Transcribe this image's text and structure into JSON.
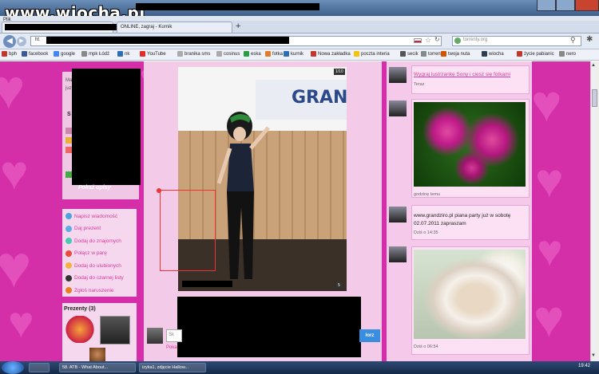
{
  "window": {
    "site_logo": "www.wiocha.pl"
  },
  "menu": {
    "first": "Plik"
  },
  "tabs": [
    {
      "label": ""
    },
    {
      "label": "ONLINE, zagraj - Kurnik"
    }
  ],
  "urlbar": {
    "url": "ht",
    "search_placeholder": "torrenty.org"
  },
  "bookmarks": [
    {
      "label": "bph",
      "color": "#c0392b"
    },
    {
      "label": "facebook",
      "color": "#3b5998"
    },
    {
      "label": "google",
      "color": "#4285f4"
    },
    {
      "label": "mpk Łódź",
      "color": "#888888"
    },
    {
      "label": "nk",
      "color": "#2d6fb5"
    },
    {
      "label": "YouTube",
      "color": "#e52d27"
    },
    {
      "label": "branika sms",
      "color": "#aaaaaa"
    },
    {
      "label": "cosinus",
      "color": "#aaaaaa"
    },
    {
      "label": "eska",
      "color": "#2a9d3f"
    },
    {
      "label": "fotka",
      "color": "#e27c2b"
    },
    {
      "label": "kurnik",
      "color": "#2d6fb5"
    },
    {
      "label": "Nowa zakładka",
      "color": "#c0392b"
    },
    {
      "label": "poczta interia",
      "color": "#f1c40f"
    },
    {
      "label": "secik",
      "color": "#555555"
    },
    {
      "label": "torrenty",
      "color": "#7f8c8d"
    },
    {
      "label": "twoja nuta",
      "color": "#d35400"
    },
    {
      "label": "wiocha",
      "color": "#2c3e50"
    },
    {
      "label": "życie pabianic",
      "color": "#c0392b"
    },
    {
      "label": "nero",
      "color": "#888888"
    }
  ],
  "left": {
    "top_line1": "Mar",
    "top_line2": "juz",
    "section_s": "S",
    "pokaz_opisy": "Pokaż opisy",
    "actions": [
      {
        "label": "Napisz wiadomość",
        "color": "#4aa3df"
      },
      {
        "label": "Daj prezent",
        "color": "#5dade2"
      },
      {
        "label": "Dodaj do znajomych",
        "color": "#48c9b0"
      },
      {
        "label": "Połącz w parę",
        "color": "#e74c3c"
      },
      {
        "label": "Dodaj do ulubionych",
        "color": "#f5b041"
      },
      {
        "label": "Dodaj do czarnej listy",
        "color": "#333333"
      },
      {
        "label": "Zgłoś naruszenie",
        "color": "#e67e22"
      }
    ],
    "gifts_title": "Prezenty (3)"
  },
  "photo": {
    "sign_text": "GRAN",
    "counter": "1/10",
    "num": "5"
  },
  "comment": {
    "placeholder": "Sk",
    "button": "łorz",
    "link": "Poka"
  },
  "feed": {
    "item1_link": "Wygraj lustrzankę Sony i ciesz się fotkami",
    "item1_time": "Teraz",
    "item2_time": "godzinę temu",
    "item3_text": "www.grandziro.pl piana party już w sobotę 02.07.2011 zapraszam",
    "item3_time": "Dziś o 14:35",
    "item4_time": "Dziś o 06:54"
  },
  "taskbar": {
    "buttons": [
      "58. ATB - What About...",
      "izyka1, zdjęcie Hallow..."
    ],
    "clock": "19:42"
  }
}
